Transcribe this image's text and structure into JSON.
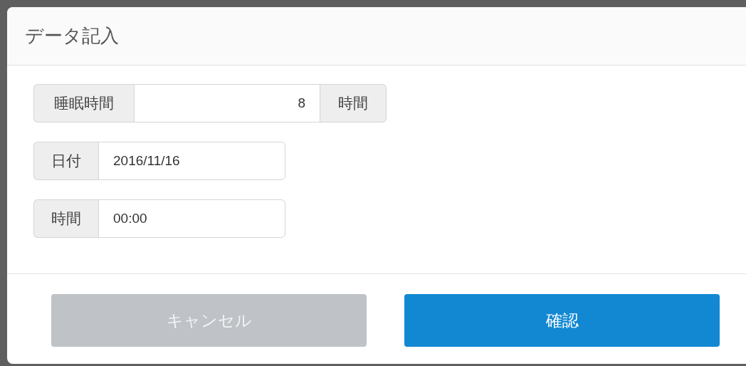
{
  "dialog": {
    "title": "データ記入"
  },
  "fields": [
    {
      "kind": "number",
      "label": "睡眠時間",
      "value": "8",
      "unit": "時間"
    },
    {
      "kind": "date",
      "label": "日付",
      "value": "2016/11/16"
    },
    {
      "kind": "time",
      "label": "時間",
      "value": "00:00"
    }
  ],
  "buttons": [
    {
      "kind": "secondary",
      "label": "キャンセル"
    },
    {
      "kind": "primary",
      "label": "確認"
    }
  ]
}
